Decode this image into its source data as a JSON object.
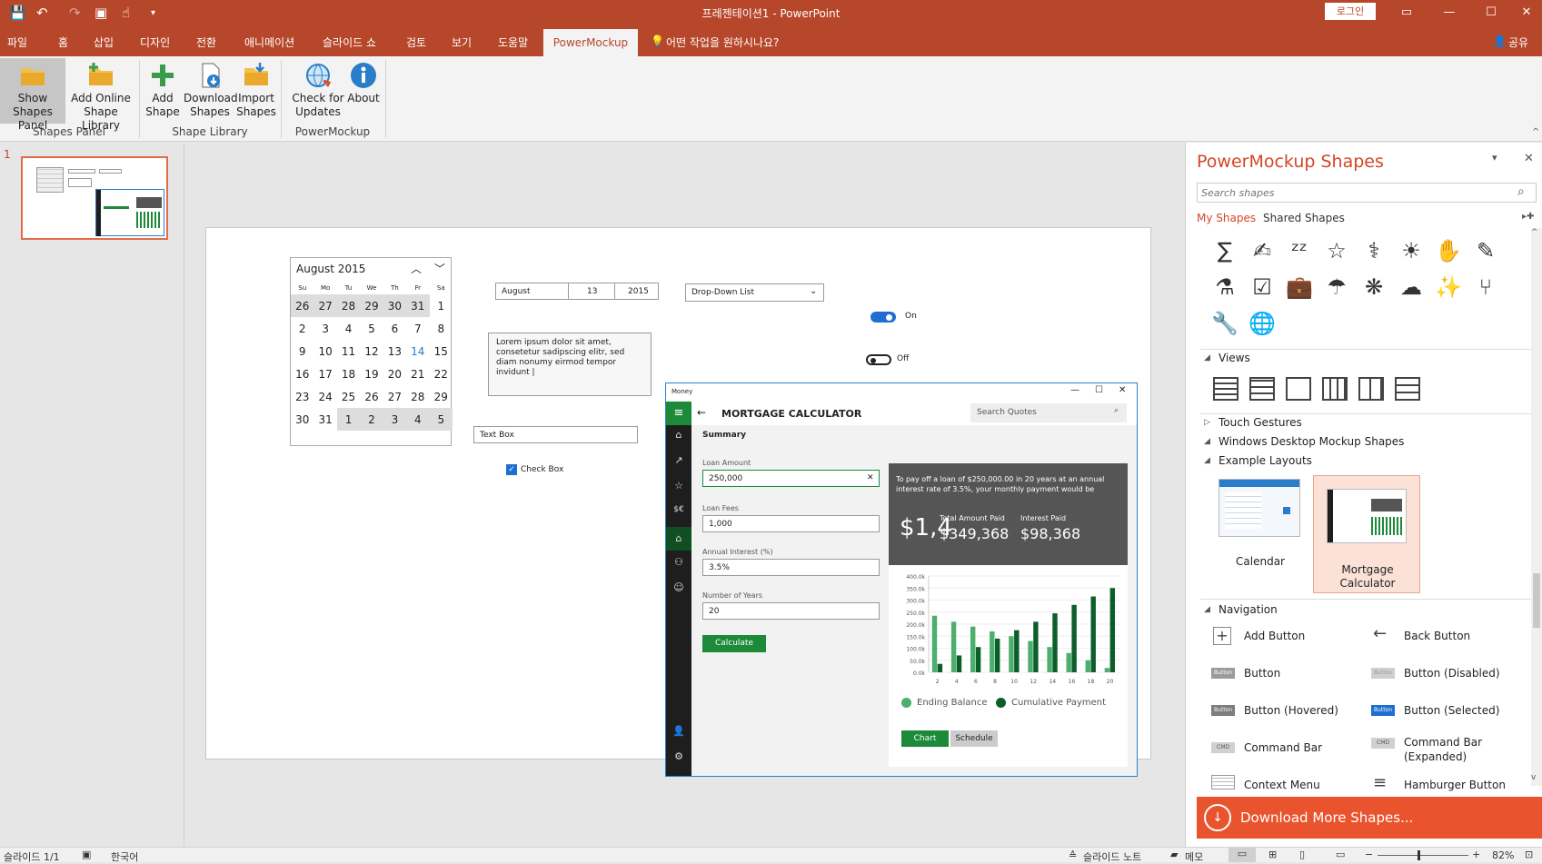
{
  "titlebar": {
    "title": "프레젠테이션1 - PowerPoint",
    "login": "로그인"
  },
  "tabs": [
    "파일",
    "홈",
    "삽입",
    "디자인",
    "전환",
    "애니메이션",
    "슬라이드 쇼",
    "검토",
    "보기",
    "도움말"
  ],
  "active_tab": "PowerMockup",
  "tell_me": "어떤 작업을 원하시나요?",
  "share": "공유",
  "ribbon": {
    "show_shapes_panel": [
      "Show",
      "Shapes Panel"
    ],
    "add_online": [
      "Add Online",
      "Shape Library"
    ],
    "add_shape": [
      "Add",
      "Shape"
    ],
    "download_shapes": [
      "Download",
      "Shapes"
    ],
    "import_shapes": [
      "Import",
      "Shapes"
    ],
    "check_updates": [
      "Check for",
      "Updates"
    ],
    "about": "About",
    "group_shapes_panel": "Shapes Panel",
    "group_shape_library": "Shape Library",
    "group_powermockup": "PowerMockup"
  },
  "thumb": {
    "number": "1"
  },
  "calendar": {
    "title": "August 2015",
    "weekdays": [
      "Su",
      "Mo",
      "Tu",
      "We",
      "Th",
      "Fr",
      "Sa"
    ],
    "rows": [
      [
        "26",
        "27",
        "28",
        "29",
        "30",
        "31",
        "1"
      ],
      [
        "2",
        "3",
        "4",
        "5",
        "6",
        "7",
        "8"
      ],
      [
        "9",
        "10",
        "11",
        "12",
        "13",
        "14",
        "15"
      ],
      [
        "16",
        "17",
        "18",
        "19",
        "20",
        "21",
        "22"
      ],
      [
        "23",
        "24",
        "25",
        "26",
        "27",
        "28",
        "29"
      ],
      [
        "30",
        "31",
        "1",
        "2",
        "3",
        "4",
        "5"
      ]
    ]
  },
  "date_picker": {
    "month": "August",
    "day": "13",
    "year": "2015"
  },
  "dropdown": "Drop-Down List",
  "toggle_on": "On",
  "toggle_off": "Off",
  "lorem": "Lorem ipsum dolor sit amet, consetetur sadipscing elitr, sed diam nonumy eirmod tempor invidunt |",
  "textbox": "Text Box",
  "checkbox": "Check Box",
  "money": {
    "window_title": "Money",
    "heading": "MORTGAGE CALCULATOR",
    "search": "Search Quotes",
    "summary": "Summary",
    "loan_amount_label": "Loan Amount",
    "loan_amount": "250,000",
    "loan_fees_label": "Loan Fees",
    "loan_fees": "1,000",
    "interest_label": "Annual Interest (%)",
    "interest": "3.5%",
    "years_label": "Number of Years",
    "years": "20",
    "calculate": "Calculate",
    "result_text": "To pay off a loan of $250,000.00 in 20 years at an annual interest rate of 3.5%, your monthly payment would be",
    "big_value": "$1,4",
    "total_label": "Total Amount Paid",
    "total_value": "$349,368",
    "interest_paid_label": "Interest Paid",
    "interest_paid_value": "$98,368",
    "tab_chart": "Chart",
    "tab_schedule": "Schedule"
  },
  "chart_data": {
    "type": "bar",
    "categories": [
      "2",
      "4",
      "6",
      "8",
      "10",
      "12",
      "14",
      "16",
      "18",
      "20"
    ],
    "series": [
      {
        "name": "Ending Balance",
        "values": [
          235,
          210,
          190,
          170,
          150,
          130,
          105,
          80,
          50,
          18
        ],
        "color": "#4caf6e"
      },
      {
        "name": "Cumulative Payment",
        "values": [
          35,
          70,
          105,
          140,
          175,
          210,
          245,
          280,
          315,
          350
        ],
        "color": "#0b5e2a"
      }
    ],
    "yticks": [
      "400.0k",
      "350.0k",
      "300.0k",
      "250.0k",
      "200.0k",
      "150.0k",
      "100.0k",
      "50.0k",
      "0.0k"
    ],
    "ylim": [
      0,
      400
    ]
  },
  "rpane": {
    "title": "PowerMockup Shapes",
    "search_placeholder": "Search shapes",
    "tab_my": "My Shapes",
    "tab_shared": "Shared Shapes",
    "icons": [
      "∑",
      "✍",
      "ᶻᶻ",
      "☆",
      "⚕",
      "☀",
      "✋",
      "✎",
      "⚗",
      "☑",
      "💼",
      "☂",
      "❋",
      "☁",
      "✨",
      "⑂",
      "🔧",
      "🌐"
    ],
    "views_label": "Views",
    "touch_gestures": "Touch Gestures",
    "windows_desktop": "Windows Desktop Mockup Shapes",
    "example_layouts": "Example Layouts",
    "layout_calendar": "Calendar",
    "layout_mortgage": [
      "Mortgage",
      "Calculator"
    ],
    "navigation": "Navigation",
    "nav_items": [
      {
        "label": "Add Button",
        "icon": "+"
      },
      {
        "label": "Back Button",
        "icon": "←"
      },
      {
        "label": "Button",
        "icon": "Button"
      },
      {
        "label": "Button (Disabled)",
        "icon": "Button"
      },
      {
        "label": "Button (Hovered)",
        "icon": "Button"
      },
      {
        "label": "Button (Selected)",
        "icon": "Button"
      },
      {
        "label": "Command Bar",
        "icon": "CMD"
      },
      {
        "label": "Command Bar\n(Expanded)",
        "icon": "CMD"
      },
      {
        "label": "Context Menu",
        "icon": ""
      },
      {
        "label": "Hamburger Button",
        "icon": "≡"
      }
    ],
    "download_more": "Download More Shapes..."
  },
  "status": {
    "slide": "슬라이드 1/1",
    "lang": "한국어",
    "notes": "슬라이드 노트",
    "memo": "메모",
    "zoom": "82%"
  }
}
